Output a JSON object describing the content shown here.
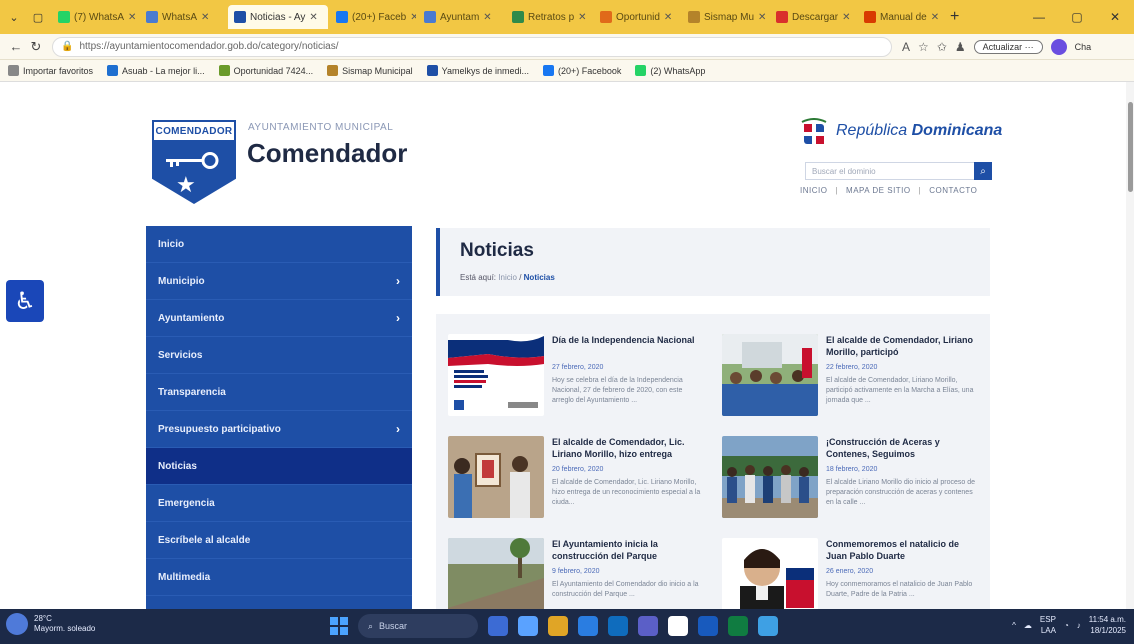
{
  "browser": {
    "tabs": [
      {
        "label": "(7) WhatsA",
        "icon": "whatsapp-icon",
        "color": "#25d366",
        "active": false
      },
      {
        "label": "WhatsA",
        "icon": "globe-icon",
        "color": "#4a7bd0",
        "active": false
      },
      {
        "label": "Noticias - Ay",
        "icon": "site-icon",
        "color": "#1e4fa6",
        "active": true
      },
      {
        "label": "(20+) Faceb",
        "icon": "facebook-icon",
        "color": "#1877f2",
        "active": false
      },
      {
        "label": "Ayuntam",
        "icon": "globe-icon",
        "color": "#4a7bd0",
        "active": false
      },
      {
        "label": "Retratos p",
        "icon": "site-icon",
        "color": "#2f8a4a",
        "active": false
      },
      {
        "label": "Oportunid",
        "icon": "site-icon",
        "color": "#e06a1a",
        "active": false
      },
      {
        "label": "Sismap Mu",
        "icon": "site-icon",
        "color": "#b4832a",
        "active": false
      },
      {
        "label": "Descargar",
        "icon": "site-icon",
        "color": "#d9302c",
        "active": false
      },
      {
        "label": "Manual de",
        "icon": "doc-icon",
        "color": "#d83b01",
        "active": false
      }
    ],
    "new_tab": "+",
    "url": "https://ayuntamientocomendador.gob.do/category/noticias/",
    "update_button": "Actualizar ···",
    "copilot_label": "Cha",
    "bookmarks": [
      {
        "label": "Importar favoritos",
        "color": "#888888"
      },
      {
        "label": "Asuab - La mejor li...",
        "color": "#1e6fd0"
      },
      {
        "label": "Oportunidad 7424...",
        "color": "#6a9a2a"
      },
      {
        "label": "Sismap Municipal",
        "color": "#b4832a"
      },
      {
        "label": "Yamelkys de inmedi...",
        "color": "#1e4fa6"
      },
      {
        "label": "(20+) Facebook",
        "color": "#1877f2"
      },
      {
        "label": "(2) WhatsApp",
        "color": "#25d366"
      }
    ]
  },
  "site": {
    "logo_text": "COMENDADOR",
    "subtitle": "AYUNTAMIENTO MUNICIPAL",
    "name": "Comendador",
    "gov_name_prefix": "República ",
    "gov_name_bold": "Dominicana",
    "search_placeholder": "Buscar el dominio",
    "top_links": [
      "INICIO",
      "MAPA DE SITIO",
      "CONTACTO"
    ]
  },
  "sidebar": {
    "items": [
      {
        "label": "Inicio",
        "has_submenu": false,
        "active": false
      },
      {
        "label": "Municipio",
        "has_submenu": true,
        "active": false
      },
      {
        "label": "Ayuntamiento",
        "has_submenu": true,
        "active": false
      },
      {
        "label": "Servicios",
        "has_submenu": false,
        "active": false
      },
      {
        "label": "Transparencia",
        "has_submenu": false,
        "active": false
      },
      {
        "label": "Presupuesto participativo",
        "has_submenu": true,
        "active": false
      },
      {
        "label": "Noticias",
        "has_submenu": false,
        "active": true
      },
      {
        "label": "Emergencia",
        "has_submenu": false,
        "active": false
      },
      {
        "label": "Escríbele al alcalde",
        "has_submenu": false,
        "active": false
      },
      {
        "label": "Multimedia",
        "has_submenu": false,
        "active": false
      }
    ]
  },
  "content": {
    "title": "Noticias",
    "breadcrumb_prefix": "Está aquí:",
    "breadcrumb_home": "Inicio",
    "breadcrumb_sep": "/",
    "breadcrumb_current": "Noticias"
  },
  "news": [
    {
      "title": "Día de la Independencia Nacional",
      "date": "27 febrero, 2020",
      "excerpt": "Hoy se celebra el día de la Independencia Nacional, 27 de febrero de 2020, con este arreglo del Ayuntamiento ...",
      "image": "flag-poster"
    },
    {
      "title": "El alcalde de Comendador, Liriano Morillo, participó",
      "date": "22 febrero, 2020",
      "excerpt": "El alcalde de Comendador, Liriano Morillo, participó activamente en la Marcha a Elías, una jornada que ...",
      "image": "meeting-photo"
    },
    {
      "title": "El alcalde de Comendador, Lic. Liriano Morillo, hizo entrega",
      "date": "20 febrero, 2020",
      "excerpt": "El alcalde de Comendador, Lic. Liriano Morillo, hizo entrega de un reconocimiento especial a la ciuda...",
      "image": "award-photo"
    },
    {
      "title": "¡Construcción de Aceras y Contenes, Seguimos",
      "date": "18 febrero, 2020",
      "excerpt": "El alcalde Liriano Morillo dio inicio al proceso de preparación construcción de aceras y contenes en la calle ...",
      "image": "crowd-photo"
    },
    {
      "title": "El Ayuntamiento inicia la construcción del Parque",
      "date": "9 febrero, 2020",
      "excerpt": "El Ayuntamiento del Comendador dio inicio a la construcción del Parque ...",
      "image": "park-photo"
    },
    {
      "title": "Conmemoremos el natalicio de Juan Pablo Duarte",
      "date": "26 enero, 2020",
      "excerpt": "Hoy conmemoramos el natalicio de Juan Pablo Duarte, Padre de la Patria ...",
      "image": "portrait-poster"
    }
  ],
  "taskbar": {
    "weather_temp": "28°C",
    "weather_desc": "Mayorm. soleado",
    "search_label": "Buscar",
    "lang_top": "ESP",
    "lang_bottom": "LAA",
    "time": "11:54 a.m.",
    "date": "18/1/2025"
  }
}
